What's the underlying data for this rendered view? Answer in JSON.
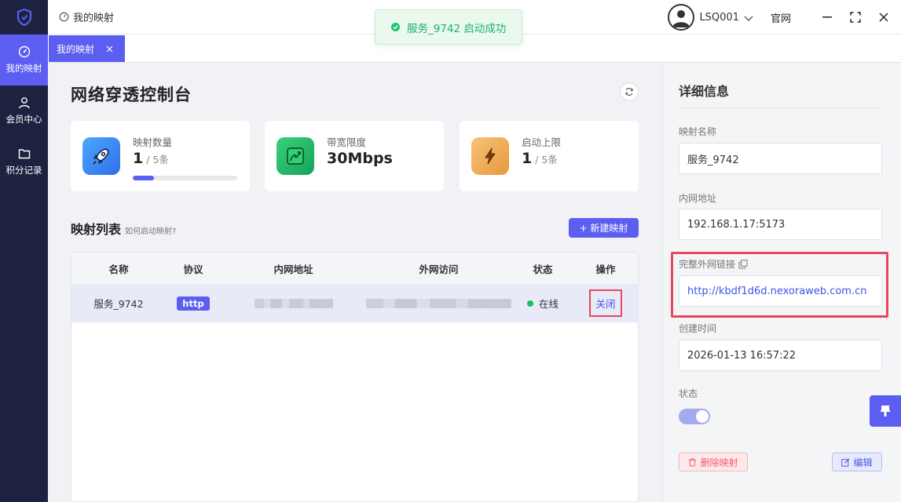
{
  "sidebar": {
    "items": [
      {
        "label": "我的映射",
        "icon": "gauge-icon",
        "active": true
      },
      {
        "label": "会员中心",
        "icon": "user-icon",
        "active": false
      },
      {
        "label": "积分记录",
        "icon": "folder-icon",
        "active": false
      }
    ]
  },
  "topbar": {
    "breadcrumb": "我的映射",
    "username": "LSQ001",
    "official_site": "官网"
  },
  "tabs": [
    {
      "label": "我的映射"
    }
  ],
  "toast": {
    "message": "服务_9742 启动成功"
  },
  "main": {
    "title": "网络穿透控制台",
    "stats": [
      {
        "label": "映射数量",
        "value": "1",
        "unit": "/ 5条",
        "progress": 0.2
      },
      {
        "label": "带宽限度",
        "value": "30Mbps"
      },
      {
        "label": "启动上限",
        "value": "1",
        "unit": "/ 5条"
      }
    ],
    "list_title": "映射列表",
    "list_hint": "如何启动映射?",
    "new_button": "+ 新建映射",
    "table": {
      "headers": [
        "名称",
        "协议",
        "内网地址",
        "外网访问",
        "状态",
        "操作"
      ],
      "rows": [
        {
          "name": "服务_9742",
          "protocol": "http",
          "status": "在线",
          "action": "关闭"
        }
      ]
    }
  },
  "detail": {
    "title": "详细信息",
    "name_label": "映射名称",
    "name_value": "服务_9742",
    "local_label": "内网地址",
    "local_value": "192.168.1.17:5173",
    "link_label": "完整外网链接",
    "link_value": "http://kbdf1d6d.nexoraweb.com.cn",
    "created_label": "创建时间",
    "created_value": "2026-01-13 16:57:22",
    "status_label": "状态",
    "status_on": true,
    "delete_button": "删除映射",
    "edit_button": "编辑"
  },
  "colors": {
    "accent": "#5b5ef0",
    "sidebar_bg": "#1d2240",
    "success": "#1dc56e",
    "danger": "#e8485f"
  }
}
